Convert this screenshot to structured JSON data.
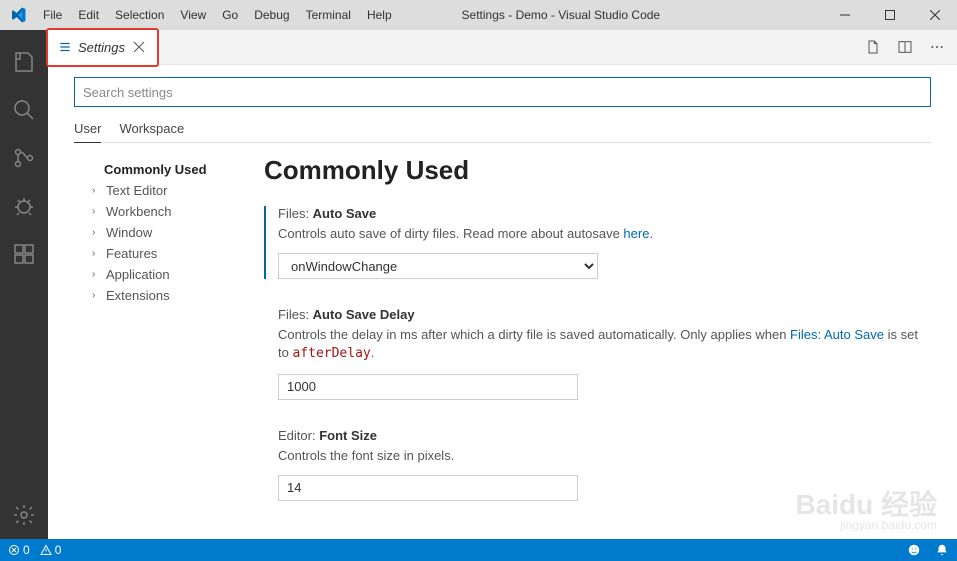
{
  "window": {
    "title": "Settings - Demo - Visual Studio Code",
    "menu": [
      "File",
      "Edit",
      "Selection",
      "View",
      "Go",
      "Debug",
      "Terminal",
      "Help"
    ]
  },
  "tab": {
    "label": "Settings"
  },
  "editor_actions": {
    "open_json_title": "Open Settings (JSON)",
    "split_title": "Split Editor",
    "more_title": "More Actions"
  },
  "search": {
    "placeholder": "Search settings"
  },
  "scopes": {
    "user": "User",
    "workspace": "Workspace"
  },
  "toc": {
    "items": [
      {
        "label": "Commonly Used",
        "active": true
      },
      {
        "label": "Text Editor"
      },
      {
        "label": "Workbench"
      },
      {
        "label": "Window"
      },
      {
        "label": "Features"
      },
      {
        "label": "Application"
      },
      {
        "label": "Extensions"
      }
    ]
  },
  "heading": "Commonly Used",
  "settings": {
    "autoSave": {
      "cat": "Files: ",
      "name": "Auto Save",
      "desc_pre": "Controls auto save of dirty files. Read more about autosave ",
      "link": "here",
      "desc_post": ".",
      "value": "onWindowChange"
    },
    "autoSaveDelay": {
      "cat": "Files: ",
      "name": "Auto Save Delay",
      "desc_pre": "Controls the delay in ms after which a dirty file is saved automatically. Only applies when ",
      "link": "Files: Auto Save",
      "desc_mid": " is set to ",
      "code": "afterDelay",
      "desc_post": ".",
      "value": "1000"
    },
    "fontSize": {
      "cat": "Editor: ",
      "name": "Font Size",
      "desc": "Controls the font size in pixels.",
      "value": "14"
    }
  },
  "statusbar": {
    "errors": "0",
    "warnings": "0"
  },
  "watermark": {
    "main": "Baidu 经验",
    "sub": "jingyan.baidu.com"
  }
}
